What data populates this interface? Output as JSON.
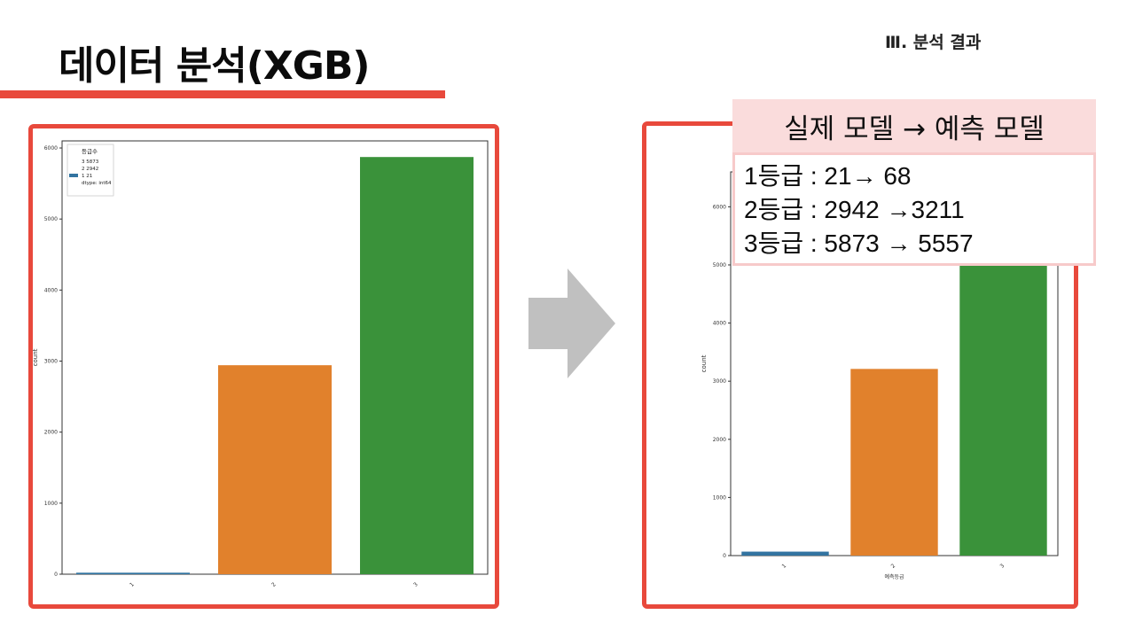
{
  "slide": {
    "title": "데이터 분석(XGB)",
    "section_label": "Ⅲ. 분석 결과"
  },
  "comparison": {
    "header": "실제 모델 → 예측 모델",
    "lines": [
      "1등급 : 21→ 68",
      "2등급 : 2942 →3211",
      "3등급 : 5873 → 5557"
    ]
  },
  "colors": {
    "accent_red": "#e8493c",
    "bar_blue": "#3274a1",
    "bar_orange": "#e1812c",
    "bar_green": "#3a923a",
    "arrow_gray": "#c0c0c0",
    "overlay_pink": "#fadcdc"
  },
  "chart_data": [
    {
      "type": "bar",
      "categories": [
        "1",
        "2",
        "3"
      ],
      "values": [
        21,
        2942,
        5873
      ],
      "ylabel": "count",
      "ylim": [
        0,
        6100
      ],
      "yticks": [
        0,
        1000,
        2000,
        3000,
        4000,
        5000,
        6000
      ],
      "legend": {
        "title": "등급수",
        "entries": [
          "3    5873",
          "2    2942",
          "1      21",
          "dtype: int64"
        ],
        "placement": "top-left"
      }
    },
    {
      "type": "bar",
      "categories": [
        "1",
        "2",
        "3"
      ],
      "values": [
        68,
        3211,
        5557
      ],
      "xlabel": "예측등급",
      "ylabel": "count",
      "ylim": [
        0,
        6600
      ],
      "yticks": [
        0,
        1000,
        2000,
        3000,
        4000,
        5000,
        6000
      ]
    }
  ]
}
